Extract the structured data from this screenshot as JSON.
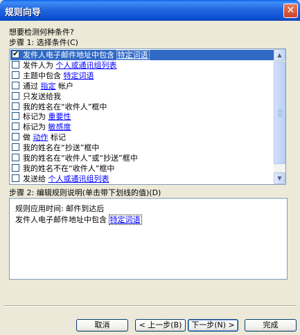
{
  "window": {
    "title": "规则向导",
    "close_glyph": "✕"
  },
  "question": "想要检测何种条件?",
  "step1": {
    "label": "步骤 1: 选择条件(C)"
  },
  "conditions": [
    {
      "selected": true,
      "checked": true,
      "parts": [
        {
          "t": "发件人电子邮件地址中包含 "
        },
        {
          "t": "特定词语",
          "link": true
        }
      ]
    },
    {
      "selected": false,
      "checked": false,
      "parts": [
        {
          "t": "发件人为 "
        },
        {
          "t": "个人或通讯组列表",
          "link": true
        }
      ]
    },
    {
      "selected": false,
      "checked": false,
      "parts": [
        {
          "t": "主题中包含 "
        },
        {
          "t": "特定词语",
          "link": true
        }
      ]
    },
    {
      "selected": false,
      "checked": false,
      "parts": [
        {
          "t": "通过 "
        },
        {
          "t": "指定",
          "link": true
        },
        {
          "t": " 帐户"
        }
      ]
    },
    {
      "selected": false,
      "checked": false,
      "parts": [
        {
          "t": "只发送给我"
        }
      ]
    },
    {
      "selected": false,
      "checked": false,
      "parts": [
        {
          "t": "我的姓名在“收件人”框中"
        }
      ]
    },
    {
      "selected": false,
      "checked": false,
      "parts": [
        {
          "t": "标记为 "
        },
        {
          "t": "重要性",
          "link": true
        }
      ]
    },
    {
      "selected": false,
      "checked": false,
      "parts": [
        {
          "t": "标记为 "
        },
        {
          "t": "敏感度",
          "link": true
        }
      ]
    },
    {
      "selected": false,
      "checked": false,
      "parts": [
        {
          "t": "做 "
        },
        {
          "t": "动作",
          "link": true
        },
        {
          "t": " 标记"
        }
      ]
    },
    {
      "selected": false,
      "checked": false,
      "parts": [
        {
          "t": "我的姓名在“抄送”框中"
        }
      ]
    },
    {
      "selected": false,
      "checked": false,
      "parts": [
        {
          "t": "我的姓名在“收件人”或“抄送”框中"
        }
      ]
    },
    {
      "selected": false,
      "checked": false,
      "parts": [
        {
          "t": "我的姓名不在“收件人”框中"
        }
      ]
    },
    {
      "selected": false,
      "checked": false,
      "parts": [
        {
          "t": "发送给 "
        },
        {
          "t": "个人或通讯组列表",
          "link": true
        }
      ]
    }
  ],
  "step2": {
    "label": "步骤 2: 编辑规则说明(单击带下划线的值)(D)"
  },
  "description": {
    "line1": "规则应用时间: 邮件到达后",
    "line2_text": "发件人电子邮件地址中包含 ",
    "line2_link": "特定词语"
  },
  "buttons": {
    "cancel": "取消",
    "back": "< 上一步(B)",
    "next": "下一步(N) >",
    "finish": "完成"
  },
  "colors": {
    "title_blue": "#0A4FD0",
    "selection": "#316AC5",
    "link": "#0000FF",
    "dialog_bg": "#ECE9D8"
  },
  "icons": {
    "check": "check-icon",
    "scroll_up": "scroll-up-arrow-icon",
    "scroll_down": "scroll-down-arrow-icon"
  }
}
